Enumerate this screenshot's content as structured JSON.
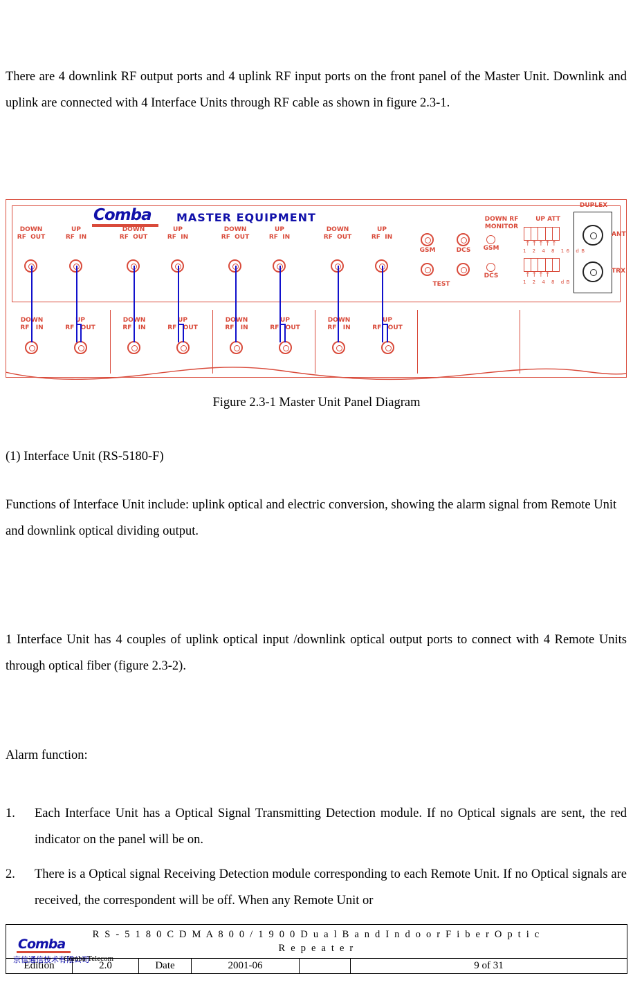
{
  "paragraphs": {
    "intro": "There are 4 downlink RF output ports and 4 uplink RF input ports on the front panel of the Master Unit. Downlink and uplink are connected with 4 Interface Units through RF cable as shown in figure 2.3-1.",
    "figure_caption": "Figure 2.3-1      Master Unit Panel Diagram",
    "section_heading": "(1)  Interface Unit (RS-5180-F)",
    "functions": "Functions of Interface Unit include: uplink optical and electric conversion, showing the alarm signal from Remote Unit and downlink optical dividing output.",
    "couples": "1 Interface Unit has 4 couples of uplink optical input /downlink optical output ports to connect with 4 Remote Units through optical fiber (figure 2.3-2).",
    "alarm_heading": "Alarm function:"
  },
  "alarm_list": [
    {
      "num": "1.",
      "text": "Each Interface Unit has a Optical Signal Transmitting Detection module. If no Optical signals are sent, the red indicator on the panel will be on."
    },
    {
      "num": "2.",
      "text": "There is a Optical signal Receiving Detection module corresponding to each Remote Unit. If no Optical signals are received, the correspondent will be off. When any Remote Unit or"
    }
  ],
  "figure": {
    "brand": "Comba",
    "title": "MASTER  EQUIPMENT",
    "top_port_labels": [
      "DOWN\nRF  OUT",
      "UP\nRF  IN",
      "DOWN\nRF  OUT",
      "UP\nRF  IN",
      "DOWN\nRF  OUT",
      "UP\nRF  IN",
      "DOWN\nRF  OUT",
      "UP\nRF  IN"
    ],
    "bottom_port_labels": [
      "DOWN\nRF   IN",
      "UP\nRF   OUT",
      "DOWN\nRF   IN",
      "UP\nRF   OUT",
      "DOWN\nRF   IN",
      "UP\nRF   OUT",
      "DOWN\nRF   IN",
      "UP\nRF   OUT"
    ],
    "test_labels": {
      "gsm": "GSM",
      "dcs": "DCS",
      "test": "TEST"
    },
    "monitor_label": "DOWN RF\nMONITOR",
    "att_label": "UP ATT",
    "att_rows": [
      {
        "name": "GSM",
        "numbers": "1 2 4 8 16 dB"
      },
      {
        "name": "DCS",
        "numbers": "1 2 4 8 dB"
      }
    ],
    "duplex_label": "DUPLEX",
    "duplex_ports": [
      "ANT",
      "TRX"
    ]
  },
  "footer": {
    "logo_text": "Comba",
    "logo_cn": "京信通信技术有限公司",
    "logo_en": "Comba Telecom",
    "doc_title_line1": "R S - 5 1 8 0 C D M A 8 0 0 / 1 9 0 0   D u a l   B a n d   I n d o o r   F i b e r   O p t i c",
    "doc_title_line2": "R e p e a t e r",
    "edition_label": "Edition",
    "edition_value": "2.0",
    "date_label": "Date",
    "date_value": "2001-06",
    "page_value": "9 of 31"
  }
}
